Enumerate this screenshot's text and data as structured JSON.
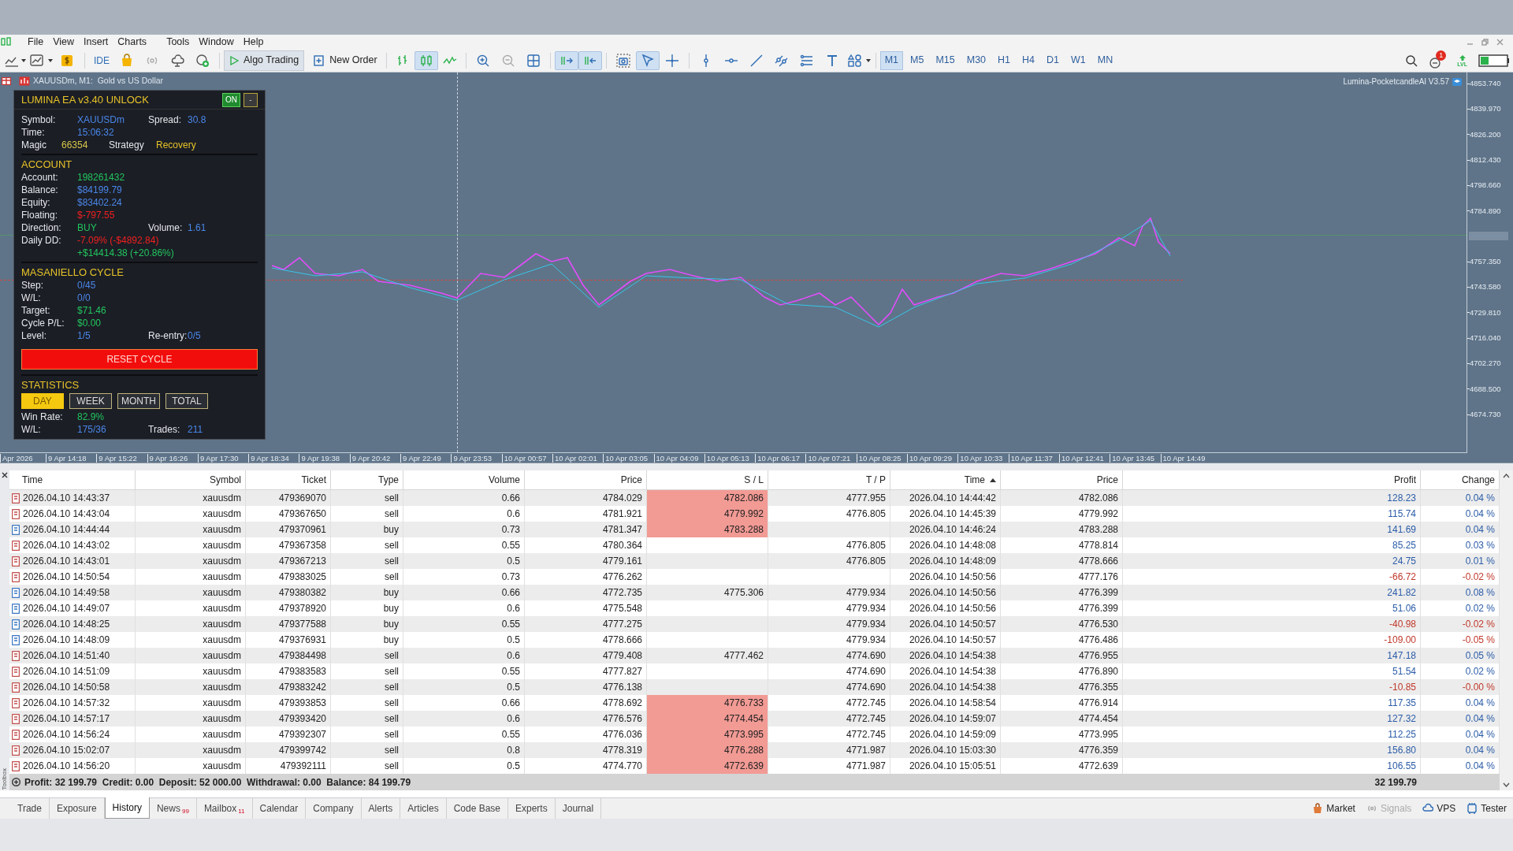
{
  "menu": [
    "File",
    "View",
    "Insert",
    "Charts",
    "Tools",
    "Window",
    "Help"
  ],
  "toolbar": {
    "ide": "IDE",
    "algo_trading": {
      "label": "Algo Trading",
      "on": true
    },
    "new_order": "New Order",
    "toggles": {
      "candlesticks": true,
      "autoscroll": true,
      "chart_shift": true,
      "cursor": true
    },
    "timeframes": [
      {
        "label": "M1",
        "selected": true
      },
      {
        "label": "M5",
        "selected": false
      },
      {
        "label": "M15",
        "selected": false
      },
      {
        "label": "M30",
        "selected": false
      },
      {
        "label": "H1",
        "selected": false
      },
      {
        "label": "H4",
        "selected": false
      },
      {
        "label": "D1",
        "selected": false
      },
      {
        "label": "W1",
        "selected": false
      },
      {
        "label": "MN",
        "selected": false
      }
    ],
    "notification_count": "1",
    "lvl": "LVL"
  },
  "chart": {
    "title": "XAUUSDm, M1:  Gold vs US Dollar",
    "indicator": "Lumina-PocketcandleAI V3.57",
    "price_ticks": [
      "4853.740",
      "4839.970",
      "4826.200",
      "4812.430",
      "4798.660",
      "4784.890",
      "4757.350",
      "4743.580",
      "4729.810",
      "4716.040",
      "4702.270",
      "4688.500",
      "4674.730"
    ],
    "time_ticks": [
      "Apr 2026",
      "9 Apr 14:18",
      "9 Apr 15:22",
      "9 Apr 16:26",
      "9 Apr 17:30",
      "9 Apr 18:34",
      "9 Apr 19:38",
      "9 Apr 20:42",
      "9 Apr 22:49",
      "9 Apr 23:53",
      "10 Apr 00:57",
      "10 Apr 02:01",
      "10 Apr 03:05",
      "10 Apr 04:09",
      "10 Apr 05:13",
      "10 Apr 06:17",
      "10 Apr 07:21",
      "10 Apr 08:25",
      "10 Apr 09:29",
      "10 Apr 10:33",
      "10 Apr 11:37",
      "10 Apr 12:41",
      "10 Apr 13:45",
      "10 Apr 14:49"
    ]
  },
  "ea_panel": {
    "title": "LUMINA EA v3.40 UNLOCK",
    "on_label": "ON",
    "on": true,
    "minimize": "-",
    "sections": [
      {
        "rows": [
          {
            "kind": "wide",
            "cells": [
              {
                "label": "Symbol:",
                "value": "XAUUSDm",
                "color": "#4a86e8"
              },
              {
                "label": "Spread:",
                "value": "30.8",
                "color": "#4a86e8"
              }
            ]
          },
          {
            "kind": "wide",
            "cells": [
              {
                "label": "Time:",
                "value": "15:06:32",
                "color": "#4a86e8"
              }
            ]
          },
          {
            "kind": "compact",
            "cells": [
              {
                "label": "Magic",
                "value": "66354",
                "color": "#d8c64a"
              },
              {
                "label": "Strategy",
                "value": "Recovery",
                "color": "#e6c229"
              }
            ]
          }
        ]
      },
      {
        "title": "ACCOUNT",
        "rows": [
          {
            "kind": "wide",
            "cells": [
              {
                "label": "Account:",
                "value": "198261432",
                "color": "#22c55e"
              }
            ]
          },
          {
            "kind": "wide",
            "cells": [
              {
                "label": "Balance:",
                "value": "$84199.79",
                "color": "#4a86e8"
              }
            ]
          },
          {
            "kind": "wide",
            "cells": [
              {
                "label": "Equity:",
                "value": "$83402.24",
                "color": "#4a86e8"
              }
            ]
          },
          {
            "kind": "wide",
            "cells": [
              {
                "label": "Floating:",
                "value": "$-797.55",
                "color": "#ef2020"
              }
            ]
          },
          {
            "kind": "wide",
            "cells": [
              {
                "label": "Direction:",
                "value": "BUY",
                "color": "#22c55e"
              },
              {
                "label": "Volume:",
                "value": "1.61",
                "color": "#4a86e8"
              }
            ]
          },
          {
            "kind": "wide",
            "cells": [
              {
                "label": "Daily DD:",
                "value": "-7.09% (-$4892.84)",
                "color": "#ef2020"
              }
            ]
          },
          {
            "kind": "wide",
            "cells": [
              {
                "value": "+$14414.38 (+20.86%)",
                "color": "#22c55e"
              }
            ]
          }
        ]
      },
      {
        "title": "MASANIELLO CYCLE",
        "rows": [
          {
            "kind": "wide",
            "cells": [
              {
                "label": "Step:",
                "value": "0/45",
                "color": "#4a86e8"
              }
            ]
          },
          {
            "kind": "wide",
            "cells": [
              {
                "label": "W/L:",
                "value": "0/0",
                "color": "#4a86e8"
              }
            ]
          },
          {
            "kind": "wide",
            "cells": [
              {
                "label": "Target:",
                "value": "$71.46",
                "color": "#22c55e"
              }
            ]
          },
          {
            "kind": "wide",
            "cells": [
              {
                "label": "Cycle P/L:",
                "value": "$0.00",
                "color": "#22c55e"
              }
            ]
          },
          {
            "kind": "wide",
            "cells": [
              {
                "label": "Level:",
                "value": "1/5",
                "color": "#4a86e8"
              },
              {
                "label": "Re-entry:",
                "value": "0/5",
                "color": "#4a86e8"
              }
            ]
          }
        ]
      }
    ],
    "reset_button": "RESET CYCLE",
    "statistics": {
      "title": "STATISTICS",
      "tabs": [
        {
          "label": "DAY",
          "selected": true
        },
        {
          "label": "WEEK",
          "selected": false
        },
        {
          "label": "MONTH",
          "selected": false
        },
        {
          "label": "TOTAL",
          "selected": false
        }
      ],
      "rows": [
        {
          "kind": "wide",
          "cells": [
            {
              "label": "Win Rate:",
              "value": "82.9%",
              "color": "#22c55e"
            }
          ]
        },
        {
          "kind": "wide",
          "cells": [
            {
              "label": "W/L:",
              "value": "175/36",
              "color": "#4a86e8"
            },
            {
              "label": "Trades:",
              "value": "211",
              "color": "#4a86e8"
            }
          ]
        }
      ]
    }
  },
  "history": {
    "columns": [
      {
        "label": "Time",
        "sorted": false
      },
      {
        "label": "Symbol",
        "sorted": false
      },
      {
        "label": "Ticket",
        "sorted": false
      },
      {
        "label": "Type",
        "sorted": false
      },
      {
        "label": "Volume",
        "sorted": false
      },
      {
        "label": "Price",
        "sorted": false
      },
      {
        "label": "S / L",
        "sorted": false
      },
      {
        "label": "T / P",
        "sorted": false
      },
      {
        "label": "Time",
        "sorted": true
      },
      {
        "label": "Price",
        "sorted": false
      },
      {
        "label": "Profit",
        "sorted": false
      },
      {
        "label": "Change",
        "sorted": false
      }
    ],
    "rows": [
      {
        "kind": "sell",
        "time": "2026.04.10 14:43:37",
        "symbol": "xauusdm",
        "ticket": "479369070",
        "type": "sell",
        "volume": "0.66",
        "price": "4784.029",
        "sl": "4782.086",
        "sl_hit": true,
        "tp": "4777.955",
        "close_time": "2026.04.10 14:44:42",
        "close_price": "4782.086",
        "profit": "128.23",
        "change": "0.04 %",
        "loss": false
      },
      {
        "kind": "sell",
        "time": "2026.04.10 14:43:04",
        "symbol": "xauusdm",
        "ticket": "479367650",
        "type": "sell",
        "volume": "0.6",
        "price": "4781.921",
        "sl": "4779.992",
        "sl_hit": true,
        "tp": "4776.805",
        "close_time": "2026.04.10 14:45:39",
        "close_price": "4779.992",
        "profit": "115.74",
        "change": "0.04 %",
        "loss": false
      },
      {
        "kind": "buy",
        "time": "2026.04.10 14:44:44",
        "symbol": "xauusdm",
        "ticket": "479370961",
        "type": "buy",
        "volume": "0.73",
        "price": "4781.347",
        "sl": "4783.288",
        "sl_hit": true,
        "close_time": "2026.04.10 14:46:24",
        "close_price": "4783.288",
        "profit": "141.69",
        "change": "0.04 %",
        "loss": false
      },
      {
        "kind": "sell",
        "time": "2026.04.10 14:43:02",
        "symbol": "xauusdm",
        "ticket": "479367358",
        "type": "sell",
        "volume": "0.55",
        "price": "4780.364",
        "tp": "4776.805",
        "close_time": "2026.04.10 14:48:08",
        "close_price": "4778.814",
        "profit": "85.25",
        "change": "0.03 %",
        "loss": false
      },
      {
        "kind": "sell",
        "time": "2026.04.10 14:43:01",
        "symbol": "xauusdm",
        "ticket": "479367213",
        "type": "sell",
        "volume": "0.5",
        "price": "4779.161",
        "tp": "4776.805",
        "close_time": "2026.04.10 14:48:09",
        "close_price": "4778.666",
        "profit": "24.75",
        "change": "0.01 %",
        "loss": false
      },
      {
        "kind": "sell",
        "time": "2026.04.10 14:50:54",
        "symbol": "xauusdm",
        "ticket": "479383025",
        "type": "sell",
        "volume": "0.73",
        "price": "4776.262",
        "close_time": "2026.04.10 14:50:56",
        "close_price": "4777.176",
        "profit": "-66.72",
        "change": "-0.02 %",
        "loss": true
      },
      {
        "kind": "buy",
        "time": "2026.04.10 14:49:58",
        "symbol": "xauusdm",
        "ticket": "479380382",
        "type": "buy",
        "volume": "0.66",
        "price": "4772.735",
        "sl": "4775.306",
        "sl_hit": false,
        "tp": "4779.934",
        "close_time": "2026.04.10 14:50:56",
        "close_price": "4776.399",
        "profit": "241.82",
        "change": "0.08 %",
        "loss": false
      },
      {
        "kind": "buy",
        "time": "2026.04.10 14:49:07",
        "symbol": "xauusdm",
        "ticket": "479378920",
        "type": "buy",
        "volume": "0.6",
        "price": "4775.548",
        "tp": "4779.934",
        "close_time": "2026.04.10 14:50:56",
        "close_price": "4776.399",
        "profit": "51.06",
        "change": "0.02 %",
        "loss": false
      },
      {
        "kind": "buy",
        "time": "2026.04.10 14:48:25",
        "symbol": "xauusdm",
        "ticket": "479377588",
        "type": "buy",
        "volume": "0.55",
        "price": "4777.275",
        "tp": "4779.934",
        "close_time": "2026.04.10 14:50:57",
        "close_price": "4776.530",
        "profit": "-40.98",
        "change": "-0.02 %",
        "loss": true
      },
      {
        "kind": "buy",
        "time": "2026.04.10 14:48:09",
        "symbol": "xauusdm",
        "ticket": "479376931",
        "type": "buy",
        "volume": "0.5",
        "price": "4778.666",
        "tp": "4779.934",
        "close_time": "2026.04.10 14:50:57",
        "close_price": "4776.486",
        "profit": "-109.00",
        "change": "-0.05 %",
        "loss": true
      },
      {
        "kind": "sell",
        "time": "2026.04.10 14:51:40",
        "symbol": "xauusdm",
        "ticket": "479384498",
        "type": "sell",
        "volume": "0.6",
        "price": "4779.408",
        "sl": "4777.462",
        "sl_hit": false,
        "tp": "4774.690",
        "close_time": "2026.04.10 14:54:38",
        "close_price": "4776.955",
        "profit": "147.18",
        "change": "0.05 %",
        "loss": false
      },
      {
        "kind": "sell",
        "time": "2026.04.10 14:51:09",
        "symbol": "xauusdm",
        "ticket": "479383583",
        "type": "sell",
        "volume": "0.55",
        "price": "4777.827",
        "tp": "4774.690",
        "close_time": "2026.04.10 14:54:38",
        "close_price": "4776.890",
        "profit": "51.54",
        "change": "0.02 %",
        "loss": false
      },
      {
        "kind": "sell",
        "time": "2026.04.10 14:50:58",
        "symbol": "xauusdm",
        "ticket": "479383242",
        "type": "sell",
        "volume": "0.5",
        "price": "4776.138",
        "tp": "4774.690",
        "close_time": "2026.04.10 14:54:38",
        "close_price": "4776.355",
        "profit": "-10.85",
        "change": "-0.00 %",
        "loss": true
      },
      {
        "kind": "sell",
        "time": "2026.04.10 14:57:32",
        "symbol": "xauusdm",
        "ticket": "479393853",
        "type": "sell",
        "volume": "0.66",
        "price": "4778.692",
        "sl": "4776.733",
        "sl_hit": true,
        "tp": "4772.745",
        "close_time": "2026.04.10 14:58:54",
        "close_price": "4776.914",
        "profit": "117.35",
        "change": "0.04 %",
        "loss": false
      },
      {
        "kind": "sell",
        "time": "2026.04.10 14:57:17",
        "symbol": "xauusdm",
        "ticket": "479393420",
        "type": "sell",
        "volume": "0.6",
        "price": "4776.576",
        "sl": "4774.454",
        "sl_hit": true,
        "tp": "4772.745",
        "close_time": "2026.04.10 14:59:07",
        "close_price": "4774.454",
        "profit": "127.32",
        "change": "0.04 %",
        "loss": false
      },
      {
        "kind": "sell",
        "time": "2026.04.10 14:56:24",
        "symbol": "xauusdm",
        "ticket": "479392307",
        "type": "sell",
        "volume": "0.55",
        "price": "4776.036",
        "sl": "4773.995",
        "sl_hit": true,
        "tp": "4772.745",
        "close_time": "2026.04.10 14:59:09",
        "close_price": "4773.995",
        "profit": "112.25",
        "change": "0.04 %",
        "loss": false
      },
      {
        "kind": "sell",
        "time": "2026.04.10 15:02:07",
        "symbol": "xauusdm",
        "ticket": "479399742",
        "type": "sell",
        "volume": "0.8",
        "price": "4778.319",
        "sl": "4776.288",
        "sl_hit": true,
        "tp": "4771.987",
        "close_time": "2026.04.10 15:03:30",
        "close_price": "4776.359",
        "profit": "156.80",
        "change": "0.04 %",
        "loss": false
      },
      {
        "kind": "sell",
        "time": "2026.04.10 14:56:20",
        "symbol": "xauusdm",
        "ticket": "479392111",
        "type": "sell",
        "volume": "0.5",
        "price": "4774.770",
        "sl": "4772.639",
        "sl_hit": true,
        "tp": "4771.987",
        "close_time": "2026.04.10 15:05:51",
        "close_price": "4772.639",
        "profit": "106.55",
        "change": "0.04 %",
        "loss": false
      }
    ],
    "summary": "Profit: 32 199.79  Credit: 0.00  Deposit: 52 000.00  Withdrawal: 0.00  Balance: 84 199.79",
    "total": "32 199.79"
  },
  "toolbox_label": "Toolbox",
  "tabs": [
    {
      "label": "Trade",
      "selected": false
    },
    {
      "label": "Exposure",
      "selected": false
    },
    {
      "label": "History",
      "selected": true
    },
    {
      "label": "News",
      "count": "99",
      "selected": false
    },
    {
      "label": "Mailbox",
      "count": "11",
      "selected": false
    },
    {
      "label": "Calendar",
      "selected": false
    },
    {
      "label": "Company",
      "selected": false
    },
    {
      "label": "Alerts",
      "selected": false
    },
    {
      "label": "Articles",
      "selected": false
    },
    {
      "label": "Code Base",
      "selected": false
    },
    {
      "label": "Experts",
      "selected": false
    },
    {
      "label": "Journal",
      "selected": false
    }
  ],
  "status": [
    {
      "kind": "market",
      "label": "Market",
      "disabled": false
    },
    {
      "kind": "signals",
      "label": "Signals",
      "disabled": true
    },
    {
      "kind": "vps",
      "label": "VPS",
      "disabled": false
    },
    {
      "kind": "tester",
      "label": "Tester",
      "disabled": false
    }
  ]
}
